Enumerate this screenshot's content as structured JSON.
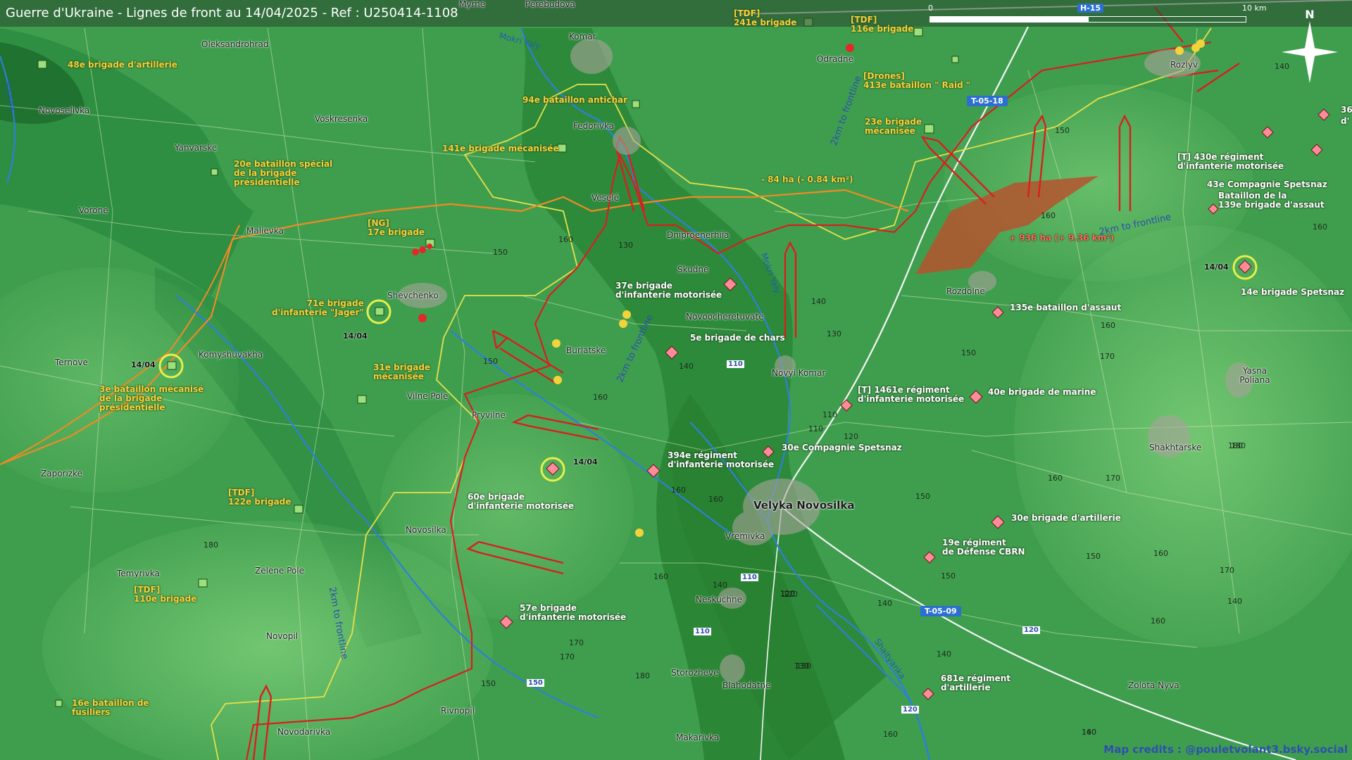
{
  "title": "Guerre d'Ukraine - Lignes de front au 14/04/2025 - Ref : U250414-1108",
  "scale": {
    "start": "0",
    "mid": "5",
    "end": "10 km"
  },
  "compass": {
    "label": "N"
  },
  "credits": "Map credits : @pouletvolant3.bsky.social",
  "colors": {
    "ukraine_unit": "#f3d23a",
    "russian_unit": "#ff8a9a",
    "attack_arrow": "#d81f1f",
    "frontline_yellow": "#e6e04a",
    "frontline_orange": "#f08a24",
    "gain_area": "#b5532e",
    "road_badge": "#2b6fd0"
  },
  "towns": [
    {
      "name": "Myrne"
    },
    {
      "name": "Perebudova"
    },
    {
      "name": "Komar"
    },
    {
      "name": "Oleksandrohrad"
    },
    {
      "name": "Odradne"
    },
    {
      "name": "Rozlyv"
    },
    {
      "name": "Novoselivka"
    },
    {
      "name": "Voskresenka"
    },
    {
      "name": "Fedorivka"
    },
    {
      "name": "Yanvarske"
    },
    {
      "name": "Vorone"
    },
    {
      "name": "Veselé"
    },
    {
      "name": "Malievka"
    },
    {
      "name": "Dniproenerhiia"
    },
    {
      "name": "Skudne"
    },
    {
      "name": "Rozdolne"
    },
    {
      "name": "Shevchenko"
    },
    {
      "name": "Novoocheretuvate"
    },
    {
      "name": "Burlatske"
    },
    {
      "name": "Ternove"
    },
    {
      "name": "Komyshuvakha"
    },
    {
      "name": "Novyi Komar"
    },
    {
      "name": "Yasna Poliana"
    },
    {
      "name": "Vilne Pole"
    },
    {
      "name": "Pryvilne"
    },
    {
      "name": "Shakhtarske"
    },
    {
      "name": "Zaporizke"
    },
    {
      "name": "Velyka Novosilka"
    },
    {
      "name": "Vremivka"
    },
    {
      "name": "Novosilka"
    },
    {
      "name": "Temyrivka"
    },
    {
      "name": "Zelene Pole"
    },
    {
      "name": "Neskuchne"
    },
    {
      "name": "Novopil"
    },
    {
      "name": "Storozheve"
    },
    {
      "name": "Blahodatne"
    },
    {
      "name": "Zolota Nyva"
    },
    {
      "name": "Rivnopil"
    },
    {
      "name": "Novodarivka"
    },
    {
      "name": "Makarivka"
    }
  ],
  "rivers": [
    {
      "name": "Mokri Yaly"
    },
    {
      "name": "Mokri Yaly"
    },
    {
      "name": "Shaityanka"
    },
    {
      "name": "Vovcha"
    }
  ],
  "ukraine_units": [
    "48e brigade d'artillerie",
    "20e bataillon spécial\nde la brigade\nprésidentielle",
    "94e bataillon antichar",
    "141e brigade mécanisée",
    "[NG]\n17e brigade",
    "71e brigade\nd'infanterie \"Jager\"",
    "31e brigade\nmécanisée",
    "3e bataillon mécanisé\nde la brigade\nprésidentielle",
    "[TDF]\n122e brigade",
    "[TDF]\n110e brigade",
    "16e bataillon de\nfusiliers",
    "[TDF]\n241e brigade",
    "[TDF]\n116e brigade",
    "[Drones]\n413e bataillon \" Raid \"",
    "23e brigade\nmécanisée"
  ],
  "russian_units": [
    "37e brigade\nd'infanterie motorisée",
    "5e brigade de chars",
    "394e régiment\nd'infanterie motorisée",
    "60e brigade\nd'infanterie motorisée",
    "57e brigade\nd'infanterie motorisée",
    "30e Compagnie Spetsnaz",
    "[T] 1461e régiment\nd'infanterie motorisée",
    "40e brigade de marine",
    "135e bataillon d'assaut",
    "[T] 430e régiment\nd'infanterie motorisée",
    "43e Compagnie Spetsnaz",
    "Bataillon de la\n139e brigade d'assaut",
    "14e brigade Spetsnaz",
    "30e brigade d'artillerie",
    "19e régiment\nde Défense CBRN",
    "681e régiment\nd'artillerie",
    "36",
    "d'"
  ],
  "dates": [
    "14/04",
    "14/04",
    "14/04",
    "14/04"
  ],
  "areas": {
    "loss": "- 84 ha (- 0.84 km²)",
    "gain": "+ 936 ha (+ 9.36 km²)"
  },
  "frontline_labels": [
    "2km to frontline",
    "2km to frontline",
    "2km to frontline",
    "2km to frontline"
  ],
  "roads": [
    "T-05-18",
    "T-05-09",
    "H-15"
  ],
  "road_numbers": [
    "110",
    "110",
    "110",
    "120",
    "120",
    "150"
  ],
  "elevations": [
    "150",
    "160",
    "140",
    "130",
    "150",
    "160",
    "170",
    "140",
    "130",
    "160",
    "150",
    "160",
    "140",
    "120",
    "110",
    "120",
    "130",
    "140",
    "150",
    "160",
    "170",
    "160",
    "180",
    "170",
    "160",
    "150",
    "140",
    "130",
    "120",
    "110",
    "180",
    "160",
    "170",
    "150",
    "140",
    "160",
    "160",
    "180",
    "170",
    "160",
    "150",
    "140",
    "130",
    "120",
    "160",
    "180",
    "160",
    "150",
    "140"
  ]
}
